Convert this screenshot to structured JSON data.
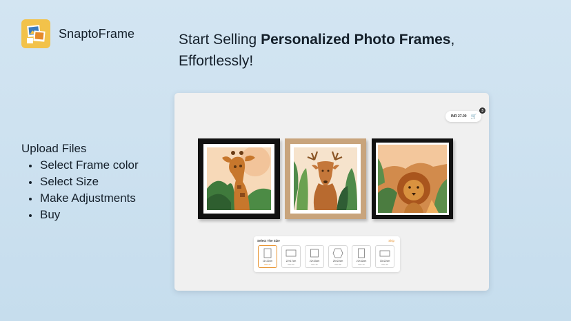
{
  "brand": {
    "name": "SnaptoFrame"
  },
  "headline": {
    "prefix": "Start Selling ",
    "bold": "Personalized Photo Frames",
    "suffix": ",",
    "line2": "Effortlessly!"
  },
  "steps": {
    "title": "Upload Files",
    "items": [
      "Select Frame color",
      "Select Size",
      "Make Adjustments",
      "Buy"
    ]
  },
  "cart": {
    "amount": "INR 27.00",
    "count": "3",
    "icon": "cart-icon"
  },
  "frames": [
    {
      "subject": "giraffe",
      "frame_color": "#111111"
    },
    {
      "subject": "deer",
      "frame_color": "#c8a47c"
    },
    {
      "subject": "lion",
      "frame_color": "#111111"
    }
  ],
  "size_selector": {
    "title": "Select The Size",
    "link": "Skip",
    "options": [
      {
        "label": "11×22cm",
        "price": "INR 27",
        "selected": true
      },
      {
        "label": "22×17cm",
        "price": "INR 30"
      },
      {
        "label": "22×33cm",
        "price": "INR 35"
      },
      {
        "label": "25×22cm",
        "price": "INR 38"
      },
      {
        "label": "22×32cm",
        "price": "INR 40"
      },
      {
        "label": "33×22cm",
        "price": "INR 45"
      }
    ]
  },
  "colors": {
    "background": "#cfe3f1",
    "accent": "#e8932f",
    "logo": "#f2c24a"
  }
}
